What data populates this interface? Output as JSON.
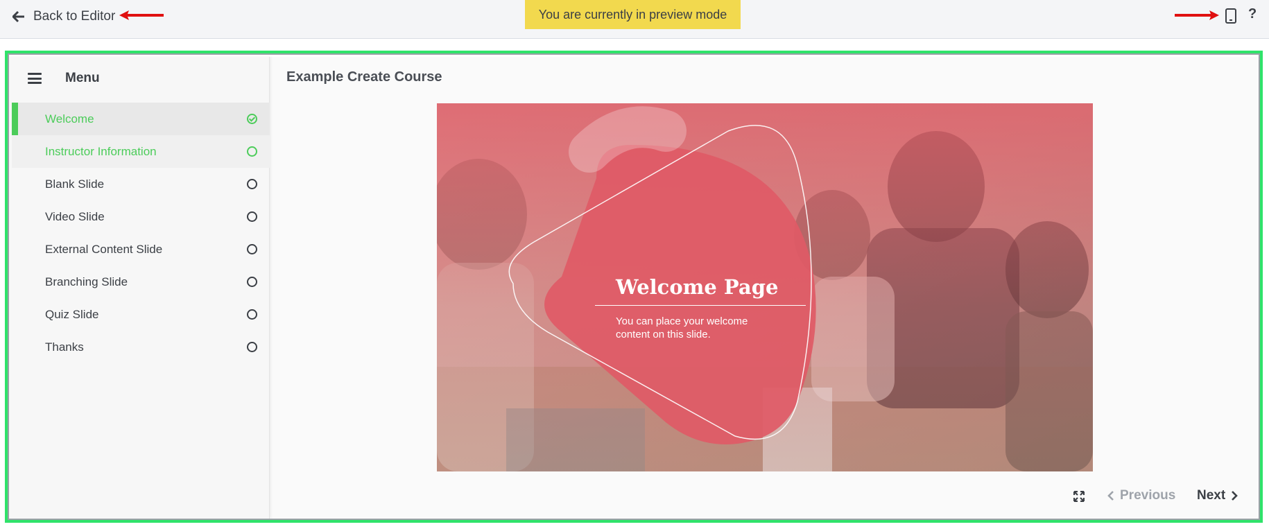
{
  "topbar": {
    "back_label": "Back to Editor",
    "preview_banner": "You are currently in preview mode",
    "help_label": "?",
    "icons": [
      "arrow-left-icon",
      "tablet-icon",
      "help-icon"
    ]
  },
  "sidebar": {
    "title": "Menu",
    "items": [
      {
        "label": "Welcome",
        "state": "current-completed"
      },
      {
        "label": "Instructor Information",
        "state": "visited"
      },
      {
        "label": "Blank Slide",
        "state": "incomplete"
      },
      {
        "label": "Video Slide",
        "state": "incomplete"
      },
      {
        "label": "External Content Slide",
        "state": "incomplete"
      },
      {
        "label": "Branching Slide",
        "state": "incomplete"
      },
      {
        "label": "Quiz Slide",
        "state": "incomplete"
      },
      {
        "label": "Thanks",
        "state": "incomplete"
      }
    ]
  },
  "main": {
    "course_title": "Example Create Course",
    "slide": {
      "heading": "Welcome Page",
      "body": "You can place your welcome content on this slide."
    },
    "controls": {
      "previous_label": "Previous",
      "next_label": "Next"
    }
  },
  "colors": {
    "accent_green": "#4ccc5a",
    "banner_yellow": "#f2d94e",
    "slide_red": "#e05a66",
    "frame_green": "#2fe36a"
  }
}
